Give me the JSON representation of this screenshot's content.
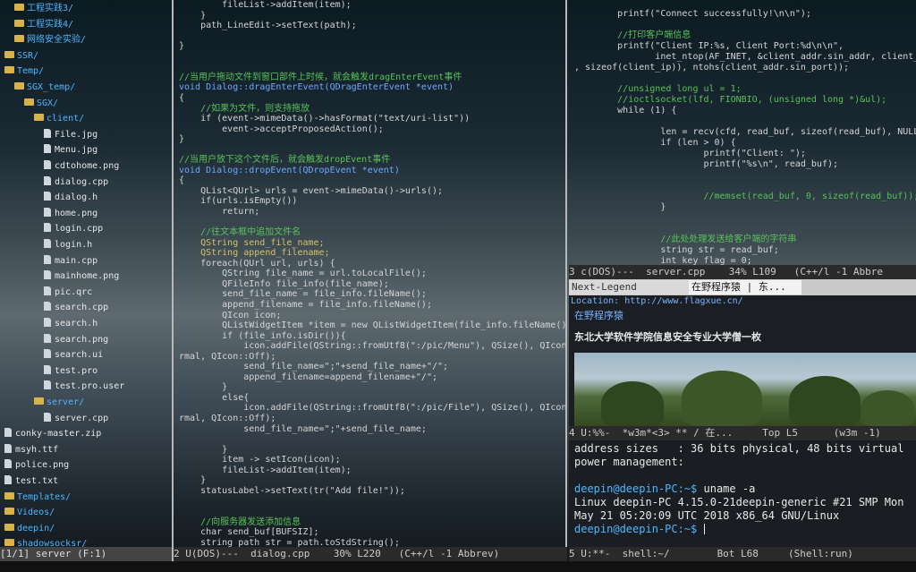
{
  "tree": {
    "items": [
      {
        "label": "工程实践3/",
        "type": "dir",
        "indent": 2
      },
      {
        "label": "工程实践4/",
        "type": "dir",
        "indent": 2
      },
      {
        "label": "网络安全实验/",
        "type": "dir",
        "indent": 2
      },
      {
        "label": "SSR/",
        "type": "dir",
        "indent": 1
      },
      {
        "label": "Temp/",
        "type": "dir",
        "indent": 1
      },
      {
        "label": "SGX_temp/",
        "type": "dir",
        "indent": 2
      },
      {
        "label": "SGX/",
        "type": "dir",
        "indent": 3
      },
      {
        "label": "client/",
        "type": "dir",
        "indent": 4
      },
      {
        "label": "File.jpg",
        "type": "file",
        "indent": 5
      },
      {
        "label": "Menu.jpg",
        "type": "file",
        "indent": 5
      },
      {
        "label": "cdtohome.png",
        "type": "file",
        "indent": 5
      },
      {
        "label": "dialog.cpp",
        "type": "file",
        "indent": 5
      },
      {
        "label": "dialog.h",
        "type": "file",
        "indent": 5
      },
      {
        "label": "home.png",
        "type": "file",
        "indent": 5
      },
      {
        "label": "login.cpp",
        "type": "file",
        "indent": 5
      },
      {
        "label": "login.h",
        "type": "file",
        "indent": 5
      },
      {
        "label": "main.cpp",
        "type": "file",
        "indent": 5
      },
      {
        "label": "mainhome.png",
        "type": "file",
        "indent": 5
      },
      {
        "label": "pic.qrc",
        "type": "file",
        "indent": 5
      },
      {
        "label": "search.cpp",
        "type": "file",
        "indent": 5
      },
      {
        "label": "search.h",
        "type": "file",
        "indent": 5
      },
      {
        "label": "search.png",
        "type": "file",
        "indent": 5
      },
      {
        "label": "search.ui",
        "type": "file",
        "indent": 5
      },
      {
        "label": "test.pro",
        "type": "file",
        "indent": 5
      },
      {
        "label": "test.pro.user",
        "type": "file",
        "indent": 5
      },
      {
        "label": "server/",
        "type": "dir",
        "indent": 4
      },
      {
        "label": "server.cpp",
        "type": "file",
        "indent": 5
      },
      {
        "label": "conky-master.zip",
        "type": "file",
        "indent": 1
      },
      {
        "label": "msyh.ttf",
        "type": "file",
        "indent": 1
      },
      {
        "label": "police.png",
        "type": "file",
        "indent": 1
      },
      {
        "label": "test.txt",
        "type": "file",
        "indent": 1
      },
      {
        "label": "Templates/",
        "type": "dir",
        "indent": 1
      },
      {
        "label": "Videos/",
        "type": "dir",
        "indent": 1
      },
      {
        "label": "deepin/",
        "type": "dir",
        "indent": 1
      },
      {
        "label": "shadowsocksr/",
        "type": "dir",
        "indent": 1
      }
    ],
    "modeline": "[1/1] server (F:1)"
  },
  "code1": {
    "lines": [
      {
        "t": "        fileList->addItem(item);",
        "c": "fn"
      },
      {
        "t": "    }",
        "c": "fn"
      },
      {
        "t": "    path_LineEdit->setText(path);",
        "c": "fn"
      },
      {
        "t": "",
        "c": "fn"
      },
      {
        "t": "}",
        "c": "fn"
      },
      {
        "t": "",
        "c": "fn"
      },
      {
        "t": "",
        "c": "fn"
      },
      {
        "t": "//当用户拖动文件到窗口部件上时候，就会触发dragEnterEvent事件",
        "c": "comment"
      },
      {
        "t": "void Dialog::dragEnterEvent(QDragEnterEvent *event)",
        "c": "type"
      },
      {
        "t": "{",
        "c": "fn"
      },
      {
        "t": "    //如果为文件，则支持拖放",
        "c": "comment"
      },
      {
        "t": "    if (event->mimeData()->hasFormat(\"text/uri-list\"))",
        "c": "fn"
      },
      {
        "t": "        event->acceptProposedAction();",
        "c": "fn"
      },
      {
        "t": "}",
        "c": "fn"
      },
      {
        "t": "",
        "c": "fn"
      },
      {
        "t": "//当用户放下这个文件后，就会触发dropEvent事件",
        "c": "comment"
      },
      {
        "t": "void Dialog::dropEvent(QDropEvent *event)",
        "c": "type"
      },
      {
        "t": "{",
        "c": "fn"
      },
      {
        "t": "    QList<QUrl> urls = event->mimeData()->urls();",
        "c": "fn"
      },
      {
        "t": "    if(urls.isEmpty())",
        "c": "fn"
      },
      {
        "t": "        return;",
        "c": "fn"
      },
      {
        "t": "",
        "c": "fn"
      },
      {
        "t": "    //往文本框中追加文件名",
        "c": "comment"
      },
      {
        "t": "    QString send_file_name;",
        "c": "var"
      },
      {
        "t": "    QString append_filename;",
        "c": "var"
      },
      {
        "t": "    foreach(QUrl url, urls) {",
        "c": "fn"
      },
      {
        "t": "        QString file_name = url.toLocalFile();",
        "c": "fn"
      },
      {
        "t": "        QFileInfo file_info(file_name);",
        "c": "fn"
      },
      {
        "t": "        send_file_name = file_info.fileName();",
        "c": "fn"
      },
      {
        "t": "        append_filename = file_info.fileName();",
        "c": "fn"
      },
      {
        "t": "        QIcon icon;",
        "c": "fn"
      },
      {
        "t": "        QListWidgetItem *item = new QListWidgetItem(file_info.fileName());",
        "c": "fn"
      },
      {
        "t": "        if (file_info.isDir()){",
        "c": "fn"
      },
      {
        "t": "            icon.addFile(QString::fromUtf8(\":/pic/Menu\"), QSize(), QIcon::No",
        "c": "fn"
      },
      {
        "t": "rmal, QIcon::Off);",
        "c": "fn"
      },
      {
        "t": "            send_file_name=\";\"+send_file_name+\"/\";",
        "c": "fn"
      },
      {
        "t": "            append_filename=append_filename+\"/\";",
        "c": "fn"
      },
      {
        "t": "        }",
        "c": "fn"
      },
      {
        "t": "        else{",
        "c": "fn"
      },
      {
        "t": "            icon.addFile(QString::fromUtf8(\":/pic/File\"), QSize(), QIcon::No",
        "c": "fn"
      },
      {
        "t": "rmal, QIcon::Off);",
        "c": "fn"
      },
      {
        "t": "            send_file_name=\";\"+send_file_name;",
        "c": "fn"
      },
      {
        "t": "",
        "c": "fn"
      },
      {
        "t": "        }",
        "c": "fn"
      },
      {
        "t": "        item -> setIcon(icon);",
        "c": "fn"
      },
      {
        "t": "        fileList->addItem(item);",
        "c": "fn"
      },
      {
        "t": "    }",
        "c": "fn"
      },
      {
        "t": "    statusLabel->setText(tr(\"Add file!\"));",
        "c": "fn"
      },
      {
        "t": "",
        "c": "fn"
      },
      {
        "t": "",
        "c": "fn"
      },
      {
        "t": "    //向服务器发送添加信息",
        "c": "comment"
      },
      {
        "t": "    char send_buf[BUFSIZ];",
        "c": "fn"
      },
      {
        "t": "    string path_str = path.toStdString();",
        "c": "fn"
      }
    ],
    "modeline": "2 U(DOS)---  dialog.cpp    30% L220   (C++/l -1 Abbrev)"
  },
  "code2": {
    "lines": [
      {
        "t": "        printf(\"Connect successfully!\\n\\n\");",
        "c": "fn"
      },
      {
        "t": "",
        "c": "fn"
      },
      {
        "t": "        //打印客户端信息",
        "c": "comment"
      },
      {
        "t": "        printf(\"Client IP:%s, Client Port:%d\\n\\n\",",
        "c": "fn"
      },
      {
        "t": "               inet_ntop(AF_INET, &client_addr.sin_addr, client_ip",
        "c": "fn"
      },
      {
        "t": ", sizeof(client_ip)), ntohs(client_addr.sin_port));",
        "c": "fn"
      },
      {
        "t": "",
        "c": "fn"
      },
      {
        "t": "        //unsigned long ul = 1;",
        "c": "comment"
      },
      {
        "t": "        //ioctlsocket(lfd, FIONBIO, (unsigned long *)&ul);",
        "c": "comment"
      },
      {
        "t": "        while (1) {",
        "c": "fn"
      },
      {
        "t": "",
        "c": "fn"
      },
      {
        "t": "                len = recv(cfd, read_buf, sizeof(read_buf), NULL);",
        "c": "fn"
      },
      {
        "t": "                if (len > 0) {",
        "c": "fn"
      },
      {
        "t": "                        printf(\"Client: \");",
        "c": "fn"
      },
      {
        "t": "                        printf(\"%s\\n\", read_buf);",
        "c": "fn"
      },
      {
        "t": "",
        "c": "fn"
      },
      {
        "t": "",
        "c": "fn"
      },
      {
        "t": "                        //memset(read_buf, 0, sizeof(read_buf));",
        "c": "comment"
      },
      {
        "t": "                }",
        "c": "fn"
      },
      {
        "t": "",
        "c": "fn"
      },
      {
        "t": "",
        "c": "fn"
      },
      {
        "t": "                //此处处理发送给客户端的字符串",
        "c": "comment"
      },
      {
        "t": "                string str = read_buf;",
        "c": "fn"
      },
      {
        "t": "                int key_flag = 0;",
        "c": "fn"
      }
    ],
    "modeline": "3 c(DOS)---  server.cpp    34% L109   (C++/l -1 Abbre"
  },
  "w3m": {
    "tab1": "Next-Legend",
    "tab2": "在野程序猿 | 东...",
    "location": "Location: http://www.flagxue.cn/",
    "site_title": "在野程序猿",
    "headline": "东北大学软件学院信息安全专业大学僧一枚",
    "modeline": "4 U:%%-  *w3m*<3> ** / 在...     Top L5      (w3m -1)"
  },
  "shell": {
    "lines": [
      {
        "t": "address sizes   : 36 bits physical, 48 bits virtual",
        "kind": "out"
      },
      {
        "t": "power management:",
        "kind": "out"
      },
      {
        "t": "",
        "kind": "out"
      },
      {
        "t": "deepin@deepin-PC:~$ ",
        "kind": "prompt",
        "cmd": "uname -a"
      },
      {
        "t": "Linux deepin-PC 4.15.0-21deepin-generic #21 SMP Mon",
        "kind": "out"
      },
      {
        "t": "May 21 05:20:09 UTC 2018 x86_64 GNU/Linux",
        "kind": "out"
      },
      {
        "t": "deepin@deepin-PC:~$ ",
        "kind": "prompt",
        "cmd": ""
      }
    ],
    "modeline": "5 U:**-  shell:~/        Bot L68     (Shell:run)"
  },
  "colors": {
    "dir": "#4db6ff",
    "comment": "#59c159",
    "accent": "#6aa9ff"
  }
}
